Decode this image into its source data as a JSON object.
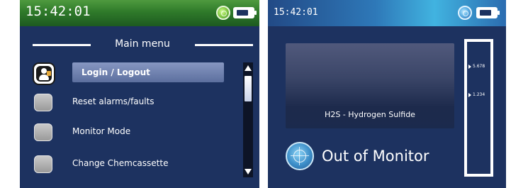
{
  "left_screen": {
    "clock": "15:42:01",
    "status_icon": "status-indicator-green",
    "battery_icon": "battery-icon",
    "menu_title": "Main menu",
    "items": [
      {
        "label": "Login / Logout",
        "icon": "user-lock-icon",
        "selected": true
      },
      {
        "label": "Reset alarms/faults",
        "icon": "blank-button-icon",
        "selected": false
      },
      {
        "label": "Monitor Mode",
        "icon": "blank-button-icon",
        "selected": false
      },
      {
        "label": "Change Chemcassette",
        "icon": "blank-button-icon",
        "selected": false
      }
    ],
    "scrollbar": {
      "up_icon": "scroll-up-arrow",
      "down_icon": "scroll-down-arrow"
    }
  },
  "right_screen": {
    "clock": "15:42:01",
    "status_icon": "status-indicator-blue",
    "battery_icon": "battery-icon",
    "gas_name": "H2S - Hydrogen Sulfide",
    "bar_ticks": [
      "5.678",
      "1.234"
    ],
    "monitor_icon": "monitor-target-icon",
    "monitor_status": "Out of Monitor"
  },
  "colors": {
    "background": "#1d3260",
    "header_green": "#2f7a2a",
    "header_blue": "#2e78b8",
    "selection": "#6f80ad",
    "text": "#ffffff"
  }
}
